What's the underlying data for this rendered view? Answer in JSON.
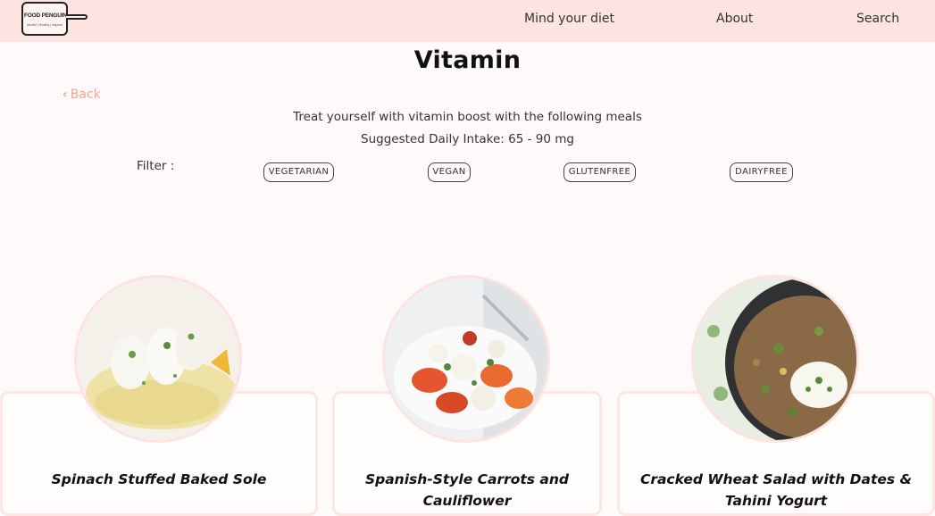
{
  "header": {
    "logo": {
      "title": "FOOD PENGUIN",
      "tagline": "Mindful | Healthy | Inspired"
    },
    "nav": [
      "Mind your diet",
      "About",
      "Search"
    ]
  },
  "page": {
    "title": "Vitamin",
    "back_label": "Back",
    "description": "Treat yourself with vitamin boost with the following meals",
    "intake": "Suggested Daily Intake: 65 - 90 mg"
  },
  "filter": {
    "label": "Filter :",
    "options": [
      "VEGETARIAN",
      "VEGAN",
      "GLUTENFREE",
      "DAIRYFREE"
    ]
  },
  "recipes": [
    {
      "name": "Spinach Stuffed Baked Sole",
      "image": "sole-dish-photo"
    },
    {
      "name": "Spanish-Style Carrots and Cauliflower",
      "image": "carrot-cauliflower-photo"
    },
    {
      "name": "Cracked Wheat Salad with Dates & Tahini Yogurt",
      "image": "wheat-salad-photo"
    }
  ],
  "colors": {
    "navbar_bg": "#fde4e1",
    "page_bg": "#fffafa",
    "back_link": "#f0a496",
    "card_border": "#fde6e3"
  },
  "icons": {
    "back": "chevron-left-icon"
  }
}
